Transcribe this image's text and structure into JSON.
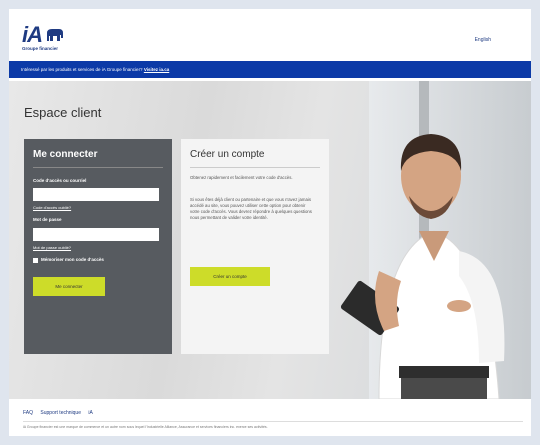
{
  "header": {
    "logo_text": "iA",
    "logo_subtext": "Groupe financier",
    "language_link": "English"
  },
  "banner": {
    "text": "Intéressé par les produits et services de iA Groupe financier? ",
    "link": "Visitez ia.ca"
  },
  "main": {
    "title": "Espace client"
  },
  "login": {
    "heading": "Me connecter",
    "username_label": "Code d'accès ou courriel",
    "username_value": "",
    "forgot_username": "Code d'accès oublié?",
    "password_label": "Mot de passe",
    "password_value": "",
    "forgot_password": "Mot de passe oublié?",
    "remember_label": "Mémoriser mon code d'accès",
    "submit_label": "Me connecter"
  },
  "create_account": {
    "heading": "Créer un compte",
    "paragraph1": "Obtenez rapidement et facilement votre code d'accès.",
    "paragraph2": "Si vous êtes déjà client ou partenaire et que vous n'avez jamais accédé au site, vous pouvez utiliser cette option pour obtenir votre code d'accès. Vous devrez répondre à quelques questions nous permettant de valider votre identité.",
    "button_label": "Créer un compte"
  },
  "footer": {
    "links": [
      "FAQ",
      "Support technique",
      "iA"
    ],
    "legal": "iA Groupe financier est une marque de commerce et un autre nom sous lequel l'Industrielle Alliance, Assurance et services financiers inc. exerce ses activités."
  },
  "colors": {
    "brand_blue": "#0c3aa7",
    "accent_lime": "#cddc29",
    "login_panel": "#575b60"
  }
}
